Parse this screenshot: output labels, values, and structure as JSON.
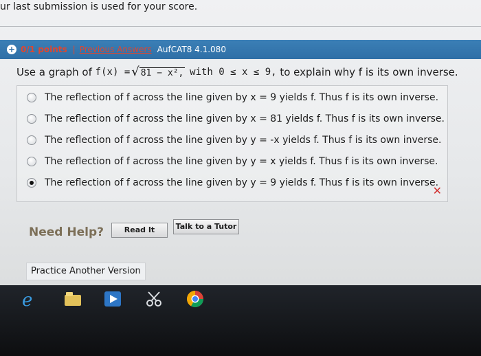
{
  "top_note": "ur last submission is used for your score.",
  "question_header": {
    "points": "0/1 points",
    "separator": "|",
    "previous_answers": "Previous Answers",
    "question_id": "AufCAT8 4.1.080"
  },
  "question": {
    "prefix": "Use a graph of",
    "function": "f(x) =",
    "radicand": "81 − x²,",
    "domain": "with 0 ≤ x ≤ 9,",
    "suffix": "to explain why f is its own inverse."
  },
  "options": [
    {
      "label": "The reflection of f across the line given by x = 9 yields f. Thus f is its own inverse.",
      "selected": false
    },
    {
      "label": "The reflection of f across the line given by x = 81 yields f. Thus f is its own inverse.",
      "selected": false
    },
    {
      "label": "The reflection of f across the line given by y = -x yields f. Thus f is its own inverse.",
      "selected": false
    },
    {
      "label": "The reflection of f across the line given by y = x yields f. Thus f is its own inverse.",
      "selected": false
    },
    {
      "label": "The reflection of f across the line given by y = 9 yields f. Thus f is its own inverse.",
      "selected": true
    }
  ],
  "result_mark": "✕",
  "help": {
    "need_help": "Need Help?",
    "read_it": "Read It",
    "talk_to_tutor": "Talk to a Tutor"
  },
  "practice_button": "Practice Another Version",
  "taskbar_icons": [
    "internet-explorer-icon",
    "file-explorer-icon",
    "media-player-icon",
    "snipping-tool-icon",
    "chrome-icon"
  ],
  "colors": {
    "header_blue": "#2f6fa6",
    "points_red": "#e0462e",
    "wrong_red": "#d22f2f"
  }
}
